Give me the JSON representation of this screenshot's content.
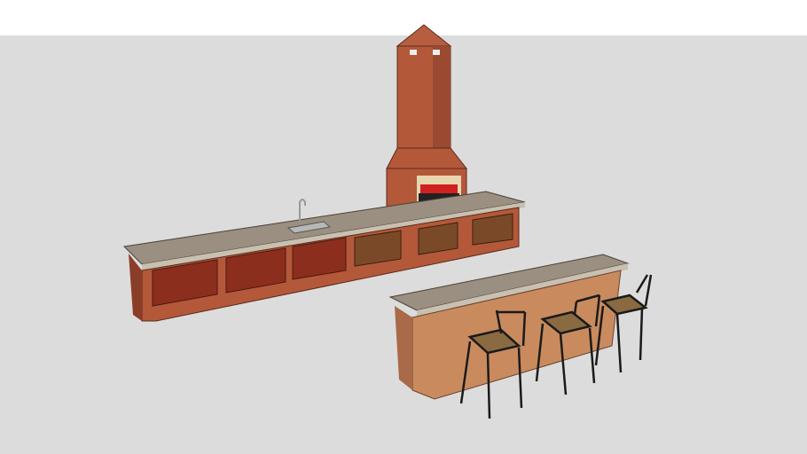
{
  "colors": {
    "sky": "#ffffff",
    "ground": "#dcdcdc",
    "brick": "#b4583a",
    "brick_dark": "#8a3e28",
    "counter_top": "#9a8f80",
    "door": "#8c2e1e",
    "stone": "#c98b5e",
    "metal": "#1a1a1a",
    "seat": "#8a6a40",
    "wood": "#7a4a28",
    "fire": "#d02020"
  }
}
